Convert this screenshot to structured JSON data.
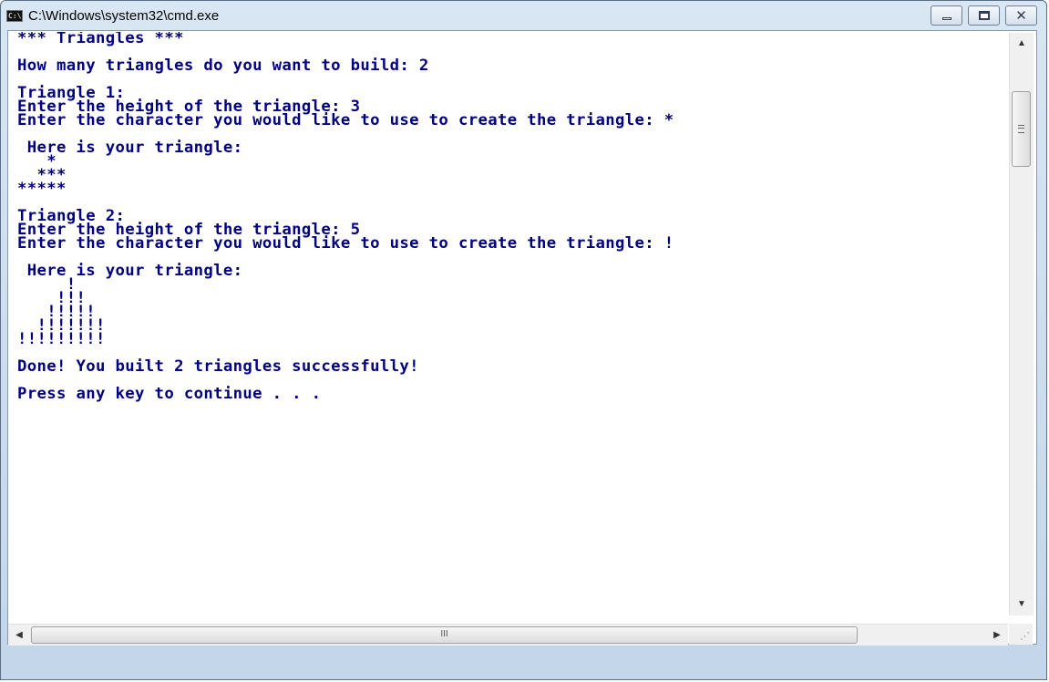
{
  "window": {
    "title": "C:\\Windows\\system32\\cmd.exe",
    "icon": "cmd-icon",
    "icon_text": "C:\\",
    "close_glyph": "✕"
  },
  "scrollbars": {
    "up_arrow": "▲",
    "down_arrow": "▼",
    "left_arrow": "◀",
    "right_arrow": "▶",
    "h_thumb_grip": "III",
    "size_grip": "⋰"
  },
  "console": {
    "lines": [
      "*** Triangles ***",
      "",
      "How many triangles do you want to build: 2",
      "",
      "Triangle 1:",
      "Enter the height of the triangle: 3",
      "Enter the character you would like to use to create the triangle: *",
      "",
      " Here is your triangle:",
      "   *",
      "  ***",
      "*****",
      "",
      "Triangle 2:",
      "Enter the height of the triangle: 5",
      "Enter the character you would like to use to create the triangle: !",
      "",
      " Here is your triangle:",
      "     !",
      "    !!!",
      "   !!!!!",
      "  !!!!!!!",
      "!!!!!!!!!",
      "",
      "Done! You built 2 triangles successfully!",
      "",
      "Press any key to continue . . ."
    ]
  },
  "colors": {
    "console_text": "#000080",
    "console_background": "#ffffff",
    "frame": "#c3d6ea"
  }
}
